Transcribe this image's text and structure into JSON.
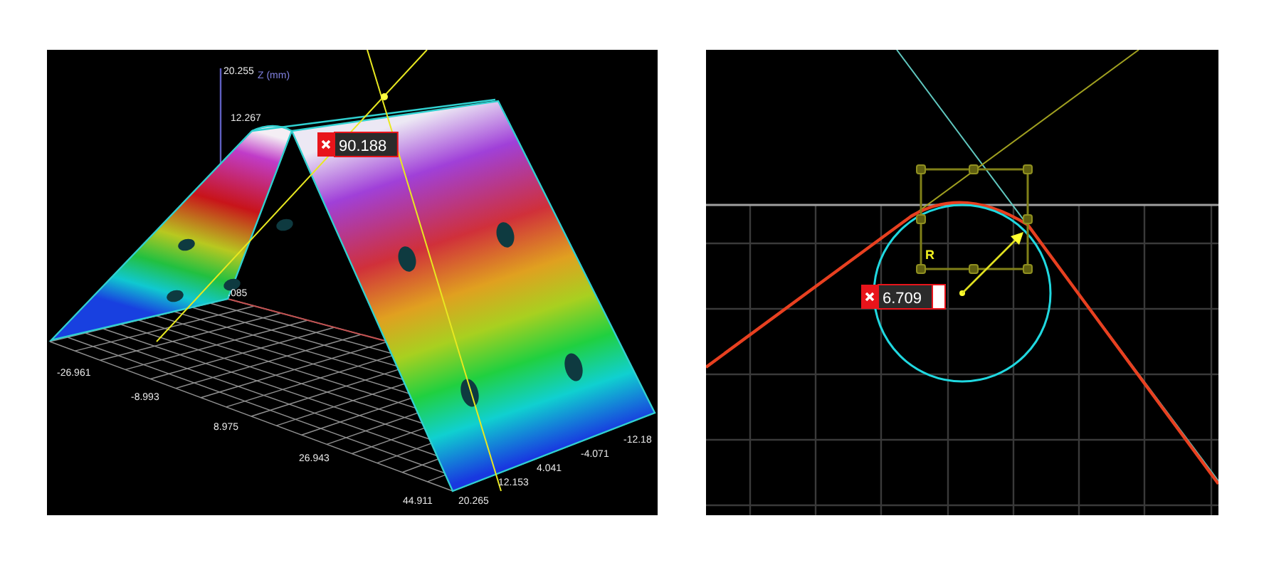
{
  "panels": [
    {
      "kind": "surface-3d",
      "z_axis": {
        "title": "Z (mm)",
        "ticks": [
          "20.255",
          "12.267",
          ".085"
        ]
      },
      "x_ticks": [
        "-26.961",
        "-8.993",
        "8.975",
        "26.943",
        "44.911"
      ],
      "y_ticks": [
        "20.265",
        "12.153",
        "4.041",
        "-4.071",
        "-12.18"
      ],
      "measurement": {
        "value": "90.188"
      }
    },
    {
      "kind": "profile-2d",
      "marker_label": "R",
      "measurement": {
        "value": "6.709"
      }
    }
  ]
}
